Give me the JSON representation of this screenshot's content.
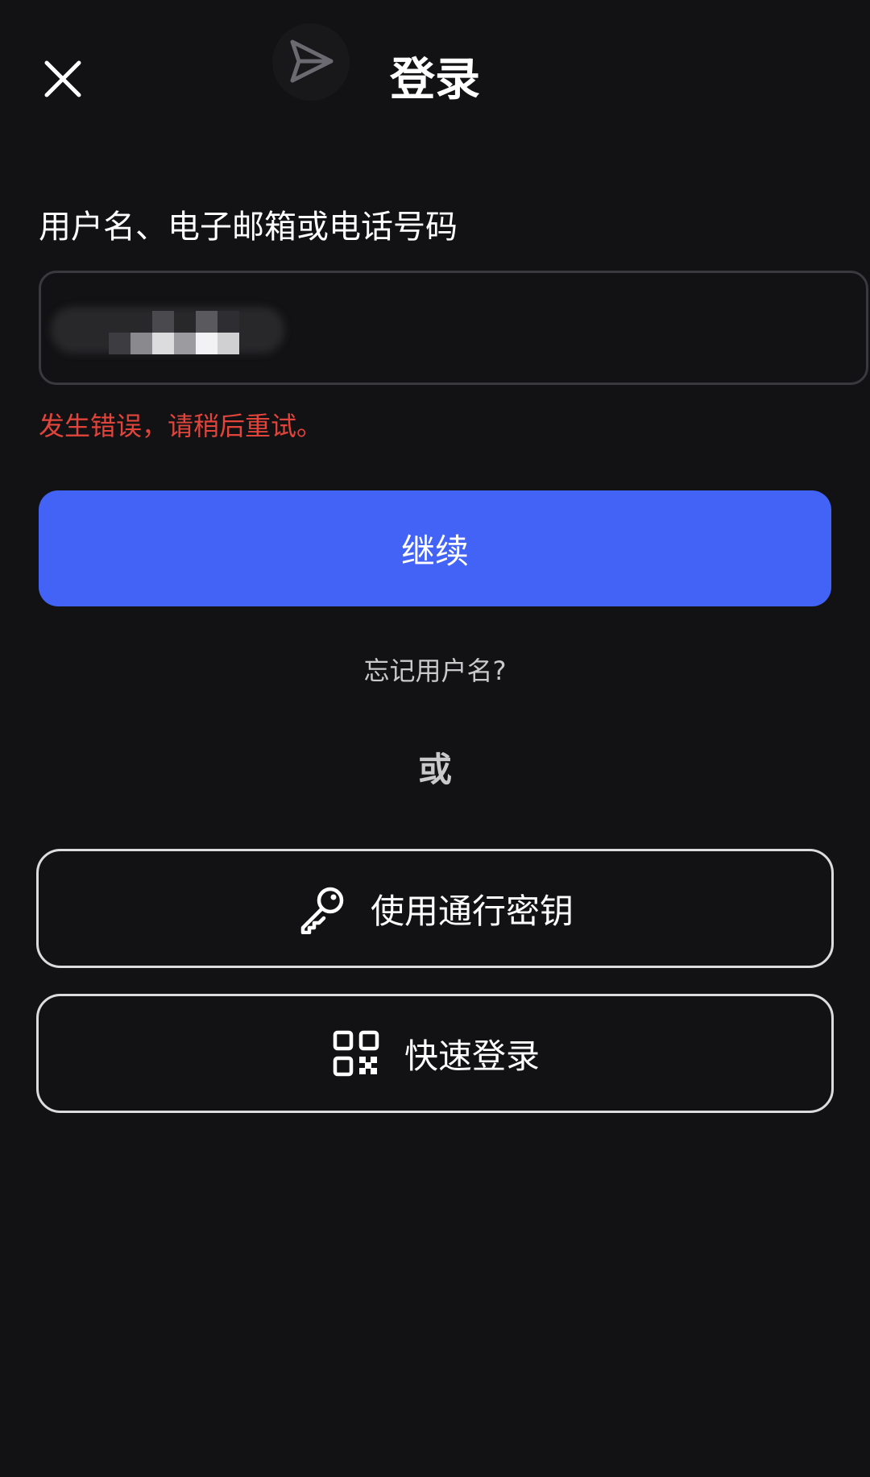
{
  "header": {
    "title": "登录",
    "close_icon": "close-icon",
    "logo_icon": "paper-plane-icon"
  },
  "login_form": {
    "field_label": "用户名、电子邮箱或电话号码",
    "input_value": "",
    "error_message": "发生错误，请稍后重试。",
    "continue_label": "继续",
    "forgot_username": "忘记用户名?"
  },
  "divider": {
    "or_text": "或"
  },
  "alt_login": {
    "passkey_label": "使用通行密钥",
    "passkey_icon": "key-icon",
    "quick_login_label": "快速登录",
    "quick_login_icon": "qr-code-icon"
  },
  "colors": {
    "background": "#121214",
    "primary_button": "#4263f5",
    "error": "#e0443a",
    "muted_text": "#c9c9cc",
    "outline": "#dcdcde"
  }
}
